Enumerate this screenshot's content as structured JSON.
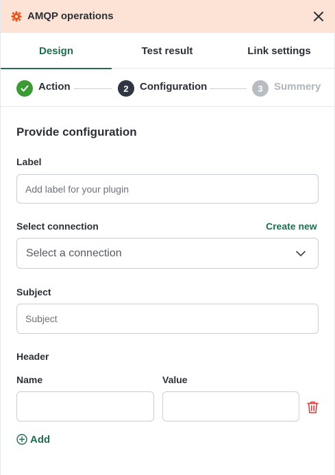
{
  "header": {
    "title": "AMQP operations",
    "plugin_icon": "gear-icon",
    "close_icon": "close-icon",
    "accent_color": "#fde3d6"
  },
  "tabs": [
    {
      "label": "Design",
      "active": true
    },
    {
      "label": "Test result",
      "active": false
    },
    {
      "label": "Link settings",
      "active": false
    }
  ],
  "steps": [
    {
      "number": "1",
      "label": "Action",
      "status": "done",
      "icon": "check-icon"
    },
    {
      "number": "2",
      "label": "Configuration",
      "status": "current"
    },
    {
      "number": "3",
      "label": "Summery",
      "status": "pending"
    }
  ],
  "form": {
    "title": "Provide configuration",
    "label_field": {
      "label": "Label",
      "placeholder": "Add label for your plugin",
      "value": ""
    },
    "connection": {
      "label": "Select connection",
      "create_new": "Create new",
      "selected": "Select a connection"
    },
    "subject": {
      "label": "Subject",
      "placeholder": "Subject",
      "value": ""
    },
    "header": {
      "label": "Header",
      "name_label": "Name",
      "value_label": "Value",
      "add_label": "Add"
    }
  },
  "colors": {
    "brand_green": "#1e6e4d",
    "step_done": "#3c9a35",
    "step_current": "#2f3542",
    "step_pending": "#b8bdc4",
    "danger": "#d63a3a",
    "plugin_orange": "#e8561c"
  }
}
